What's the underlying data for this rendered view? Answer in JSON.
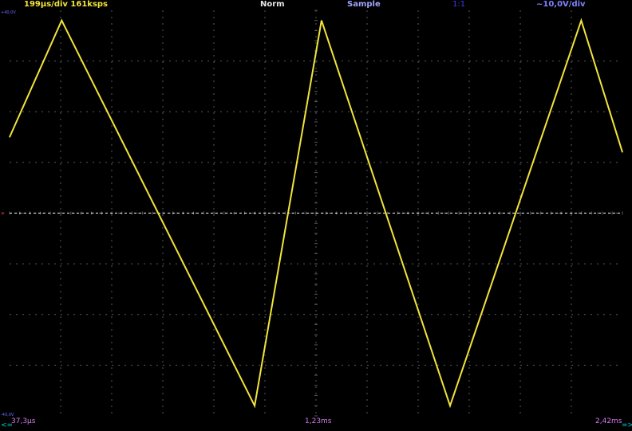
{
  "header": {
    "timebase": "199µs/div  161ksps",
    "trigger_mode": "Norm",
    "acquisition": "Sample",
    "probe": "1:1",
    "volts_per_div": "~10,0V/div"
  },
  "footer": {
    "x_left": "37,3µs",
    "x_mid": "1,23ms",
    "x_right": "2,42ms",
    "arrow_left": "<=",
    "arrow_right": "=>"
  },
  "axis_labels": {
    "y_top": "+40,0V",
    "y_bottom": "-40,0V",
    "channel_marker": "»"
  },
  "colors": {
    "background": "#000000",
    "trace": "#f2e43a",
    "grid": "#5a5a5a",
    "trigger_level": "#ffffff",
    "time_labels": "#d67bf0",
    "scroll_arrows": "#00d0d0"
  },
  "chart_data": {
    "type": "line",
    "signal": "triangle",
    "x_unit": "ms",
    "y_unit": "V",
    "xlim": [
      0.0373,
      2.42
    ],
    "ylim": [
      -40,
      40
    ],
    "divisions": {
      "x": 12,
      "y": 8
    },
    "trigger_level": 0,
    "x": [
      0.0373,
      0.24,
      0.99,
      1.25,
      1.75,
      2.26,
      2.42
    ],
    "y": [
      15,
      38,
      -38,
      38,
      -38,
      38,
      12
    ]
  }
}
